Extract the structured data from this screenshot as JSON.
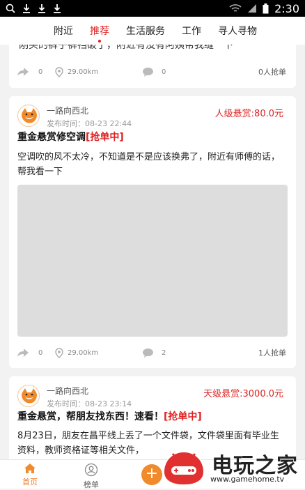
{
  "status_bar": {
    "time": "2:30"
  },
  "tabs": [
    {
      "label": "附近"
    },
    {
      "label": "推荐"
    },
    {
      "label": "生活服务"
    },
    {
      "label": "工作"
    },
    {
      "label": "寻人寻物"
    }
  ],
  "card0": {
    "cut_text": "刚买的裤子裤裆破了，附近有没有阿姨帮我缝一下",
    "shares": "0",
    "distance": "29.00km",
    "comments": "0",
    "grabs": "0人抢单"
  },
  "card1": {
    "user": "一路向西北",
    "time": "发布时间：08-23 22:44",
    "reward": "人级悬赏:80.0元",
    "title": "重金悬赏修空调",
    "tag": "[抢单中]",
    "body": "空调吹的风不太冷，不知道是不是应该换弗了，附近有师傅的话，帮我看一下",
    "shares": "0",
    "distance": "29.00km",
    "comments": "2",
    "grabs": "1人抢单"
  },
  "card2": {
    "user": "一路向西北",
    "time": "发布时间：08-23 23:14",
    "reward": "天级悬赏:3000.0元",
    "title": "重金悬赏，帮朋友找东西！速看！",
    "tag": "[抢单中]",
    "body": "8月23日，朋友在昌平线上丢了一个文件袋，文件袋里面有毕业生资料，教师资格证等相关文件，"
  },
  "bottom_nav": [
    {
      "label": "首页"
    },
    {
      "label": "榜单"
    }
  ],
  "watermark": {
    "title": "电玩之家",
    "url": "www.gamehome.tv"
  },
  "colors": {
    "accent": "#d22222",
    "orange": "#f08a2a"
  }
}
